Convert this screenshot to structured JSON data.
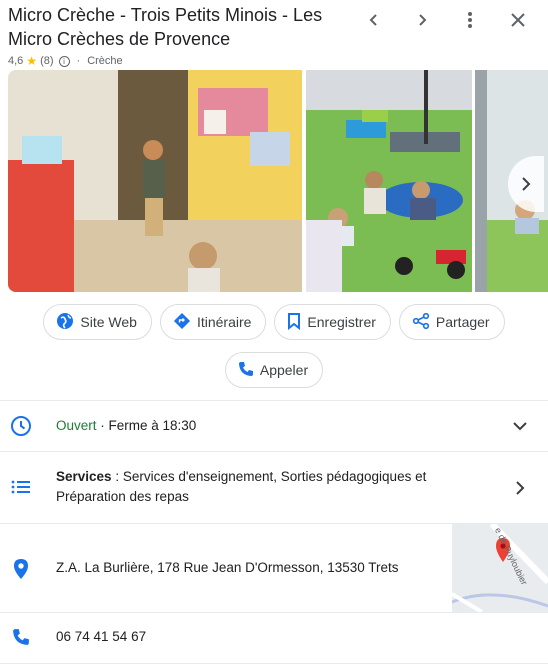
{
  "header": {
    "title": "Micro Crèche - Trois Petits Minois - Les Micro Crèches de Provence",
    "rating": "4,6",
    "reviews": "(8)",
    "category": "Crèche"
  },
  "actions": {
    "website": "Site Web",
    "directions": "Itinéraire",
    "save": "Enregistrer",
    "share": "Partager",
    "call": "Appeler"
  },
  "hours": {
    "status": "Ouvert",
    "closing": " · Ferme à 18:30"
  },
  "services": {
    "label": "Services",
    "text": " : Services d'enseignement, Sorties pédagogiques et Préparation des repas"
  },
  "address": "Z.A. La Burlière, 178 Rue Jean D'Ormesson, 13530 Trets",
  "phone": "06 74 41 54 67",
  "map_street_label": "e de Puyloubier",
  "colors": {
    "accent": "#1a73e8",
    "open": "#188038",
    "pin": "#ea4335"
  }
}
